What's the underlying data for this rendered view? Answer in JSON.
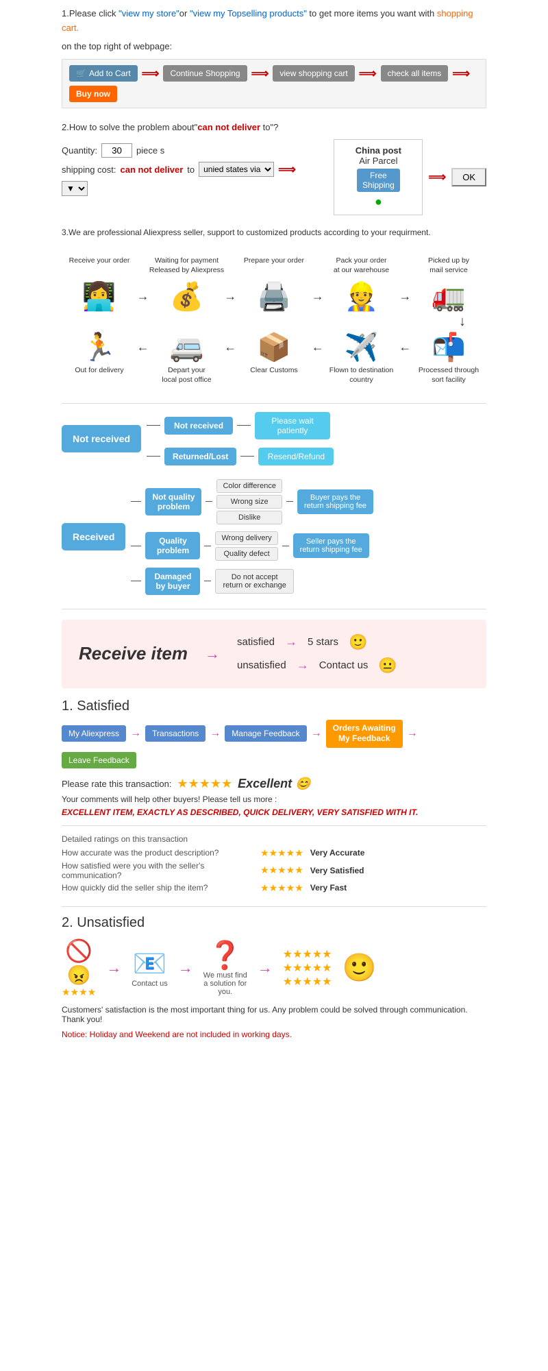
{
  "step1": {
    "text1": "1.Please click ",
    "link1": "\"view my store\"",
    "text2": "or ",
    "link2": "\"view my Topselling products\"",
    "text3": " to get more items you want with",
    "link3": "shopping cart.",
    "text4": "on the top right of webpage:",
    "buttons": {
      "addcart": "Add to Cart",
      "continue": "Continue Shopping",
      "viewcart": "view shopping cart",
      "checkall": "check all items",
      "buynow": "Buy now"
    }
  },
  "step2": {
    "title": "2.How to solve the problem about\"can not deliver to\"?",
    "qty_label": "Quantity:",
    "qty_value": "30",
    "qty_unit": "piece s",
    "ship_label": "shipping cost:",
    "cant_deliver": "can not deliver",
    "to_text": " to ",
    "dropdown_value": "unied states via",
    "china_post": {
      "line1": "China post",
      "line2": "Air Parcel",
      "free": "Free",
      "shipping": "Shipping",
      "dot": "●"
    },
    "ok_btn": "OK"
  },
  "step3": {
    "text": "3.We are professional Aliexpress seller, support to customized products according to your requirment."
  },
  "process": {
    "top_labels": [
      "Receive your order",
      "Waiting for payment\nReleased by Aliexpress",
      "Prepare your order",
      "Pack your order\nat our warehouse",
      "Picked up by\nmail service"
    ],
    "top_icons": [
      "🧑‍💻",
      "💰",
      "🖨️",
      "👷",
      "🚛"
    ],
    "bottom_icons": [
      "🏃",
      "🚐",
      "📦",
      "✈️",
      "📬"
    ],
    "bottom_labels": [
      "Out for delivery",
      "Depart your\nlocal post office",
      "Clear Customs",
      "Flown to destination\ncountry",
      "Processed through\nsort facility"
    ]
  },
  "not_received": {
    "root": "Not received",
    "branches": [
      {
        "label": "Not received",
        "outcome": "Please wait\npatiently"
      },
      {
        "label": "Returned/Lost",
        "outcome": "Resend/Refund"
      }
    ]
  },
  "received": {
    "root": "Received",
    "branches": [
      {
        "label": "Not quality\nproblem",
        "sub": [
          "Color difference",
          "Wrong size",
          "Dislike"
        ],
        "outcome": "Buyer pays the\nreturn shipping fee"
      },
      {
        "label": "Quality\nproblem",
        "sub": [
          "Wrong delivery",
          "Quality defect"
        ],
        "outcome": "Seller pays the\nreturn shipping fee"
      },
      {
        "label": "Damaged\nby buyer",
        "sub": [
          "Do not accept\nreturn or exchange"
        ],
        "outcome": ""
      }
    ]
  },
  "receive_banner": {
    "title": "Receive item",
    "rows": [
      {
        "arrow": "→",
        "label": "satisfied",
        "arrow2": "→",
        "result": "5 stars",
        "emoji": "🙂"
      },
      {
        "arrow": "→",
        "label": "unsatisfied",
        "arrow2": "→",
        "result": "Contact us",
        "emoji": "😐"
      }
    ]
  },
  "satisfied": {
    "section_num": "1.",
    "title": "Satisfied",
    "flow": [
      "My Aliexpress",
      "Transactions",
      "Manage Feedback",
      "Orders Awaiting\nMy Feedback",
      "Leave Feedback"
    ],
    "rate_label": "Please rate this transaction:",
    "stars": "★★★★★",
    "excellent": "Excellent",
    "comment1": "Your comments will help other buyers! Please tell us more :",
    "excellent_cap": "EXCELLENT ITEM, EXACTLY AS DESCRIBED, QUICK DELIVERY, VERY SATISFIED WITH IT.",
    "ratings_title": "Detailed ratings on this transaction",
    "ratings": [
      {
        "label": "How accurate was the product description?",
        "stars": "★★★★★",
        "value": "Very Accurate"
      },
      {
        "label": "How satisfied were you with the seller's communication?",
        "stars": "★★★★★",
        "value": "Very Satisfied"
      },
      {
        "label": "How quickly did the seller ship the item?",
        "stars": "★★★★★",
        "value": "Very Fast"
      }
    ]
  },
  "unsatisfied": {
    "section_num": "2.",
    "title": "Unsatisfied",
    "icons": [
      "🚫",
      "😠",
      "📧",
      "❓",
      "⭐⭐⭐⭐⭐"
    ],
    "flow_labels": [
      "",
      "Contact us",
      "We must find\na solution for\nyou."
    ],
    "notice": "Customers' satisfaction is the most important thing for us. Any problem could be solved through communication. Thank you!",
    "holiday_notice": "Notice: Holiday and Weekend are not included in working days."
  }
}
